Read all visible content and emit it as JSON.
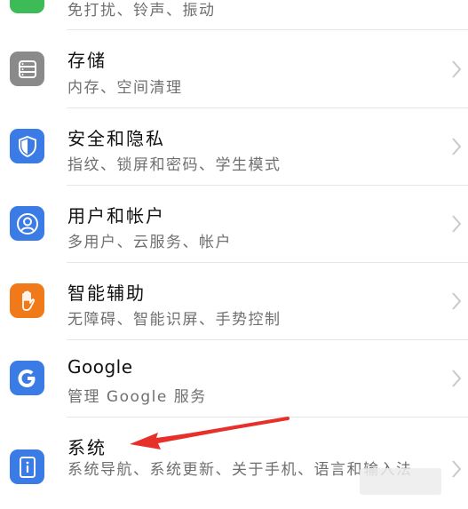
{
  "colors": {
    "security_icon": "#3a7be6",
    "account_icon": "#3a7be6",
    "accessibility_icon": "#f07a1a",
    "google_icon": "#3a7be6",
    "storage_icon": "#8a8a8a",
    "system_icon": "#3a7be6",
    "sound_icon_partial": "#3dbb57",
    "annotation_arrow": "#e8302a",
    "chevron": "#c9c9c9"
  },
  "items": [
    {
      "subtitle": "免打扰、铃声、振动"
    },
    {
      "title": "存储",
      "subtitle": "内存、空间清理",
      "icon": "storage-icon"
    },
    {
      "title": "安全和隐私",
      "subtitle": "指纹、锁屏和密码、学生模式",
      "icon": "shield-icon"
    },
    {
      "title": "用户和帐户",
      "subtitle": "多用户、云服务、帐户",
      "icon": "user-icon"
    },
    {
      "title": "智能辅助",
      "subtitle": "无障碍、智能识屏、手势控制",
      "icon": "hand-icon"
    },
    {
      "title": "Google",
      "subtitle": "管理 Google 服务",
      "icon": "google-g-icon"
    },
    {
      "title": "系统",
      "subtitle": "系统导航、系统更新、关于手机、语言和输入法",
      "icon": "info-phone-icon"
    }
  ]
}
